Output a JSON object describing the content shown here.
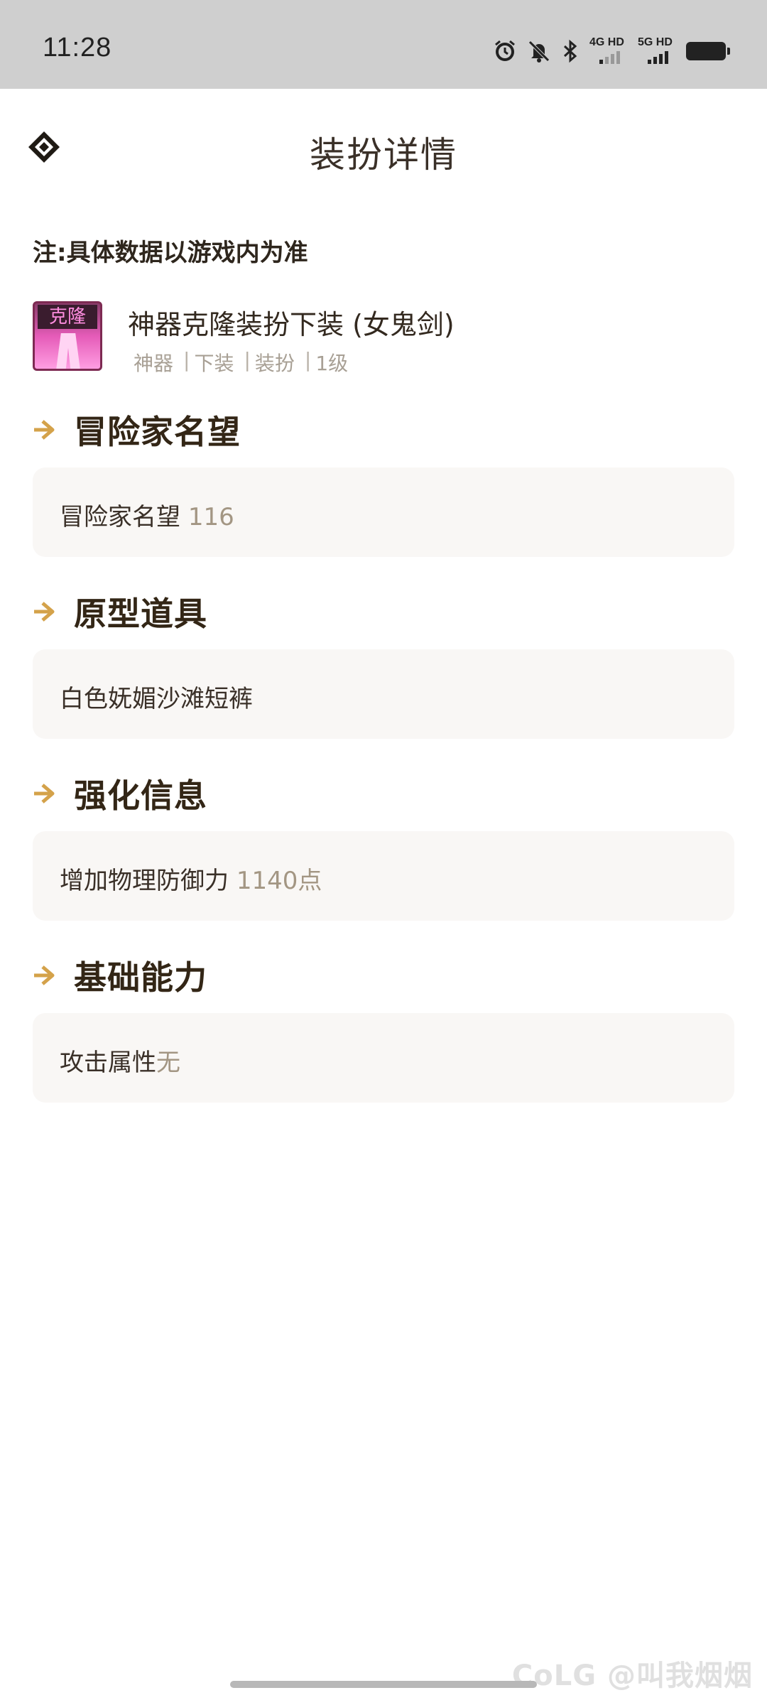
{
  "status_bar": {
    "time": "11:28",
    "network_1": "4G HD",
    "network_2": "5G HD",
    "icons": [
      "alarm-icon",
      "mute-bell-icon",
      "bluetooth-icon",
      "signal-icon",
      "signal-icon",
      "battery-icon"
    ]
  },
  "header": {
    "title": "装扮详情",
    "back_icon": "diamond-back-icon"
  },
  "note": "注:具体数据以游戏内为准",
  "item": {
    "icon_text": "克隆",
    "name": "神器克隆装扮下装 (女鬼剑)",
    "tags": [
      "神器",
      "下装",
      "装扮",
      "1级"
    ]
  },
  "sections": [
    {
      "title": "冒险家名望",
      "label": "冒险家名望 ",
      "value": "116"
    },
    {
      "title": "原型道具",
      "label": "白色妩媚沙滩短裤",
      "value": ""
    },
    {
      "title": "强化信息",
      "label": "增加物理防御力 ",
      "value": "1140点"
    },
    {
      "title": "基础能力",
      "label": "攻击属性",
      "value": "无"
    }
  ],
  "watermark": "CoLG @叫我烟烟",
  "colors": {
    "accent": "#d4a24a",
    "title_text": "#332616",
    "value_text": "#a39683",
    "box_bg": "#f9f7f5"
  }
}
